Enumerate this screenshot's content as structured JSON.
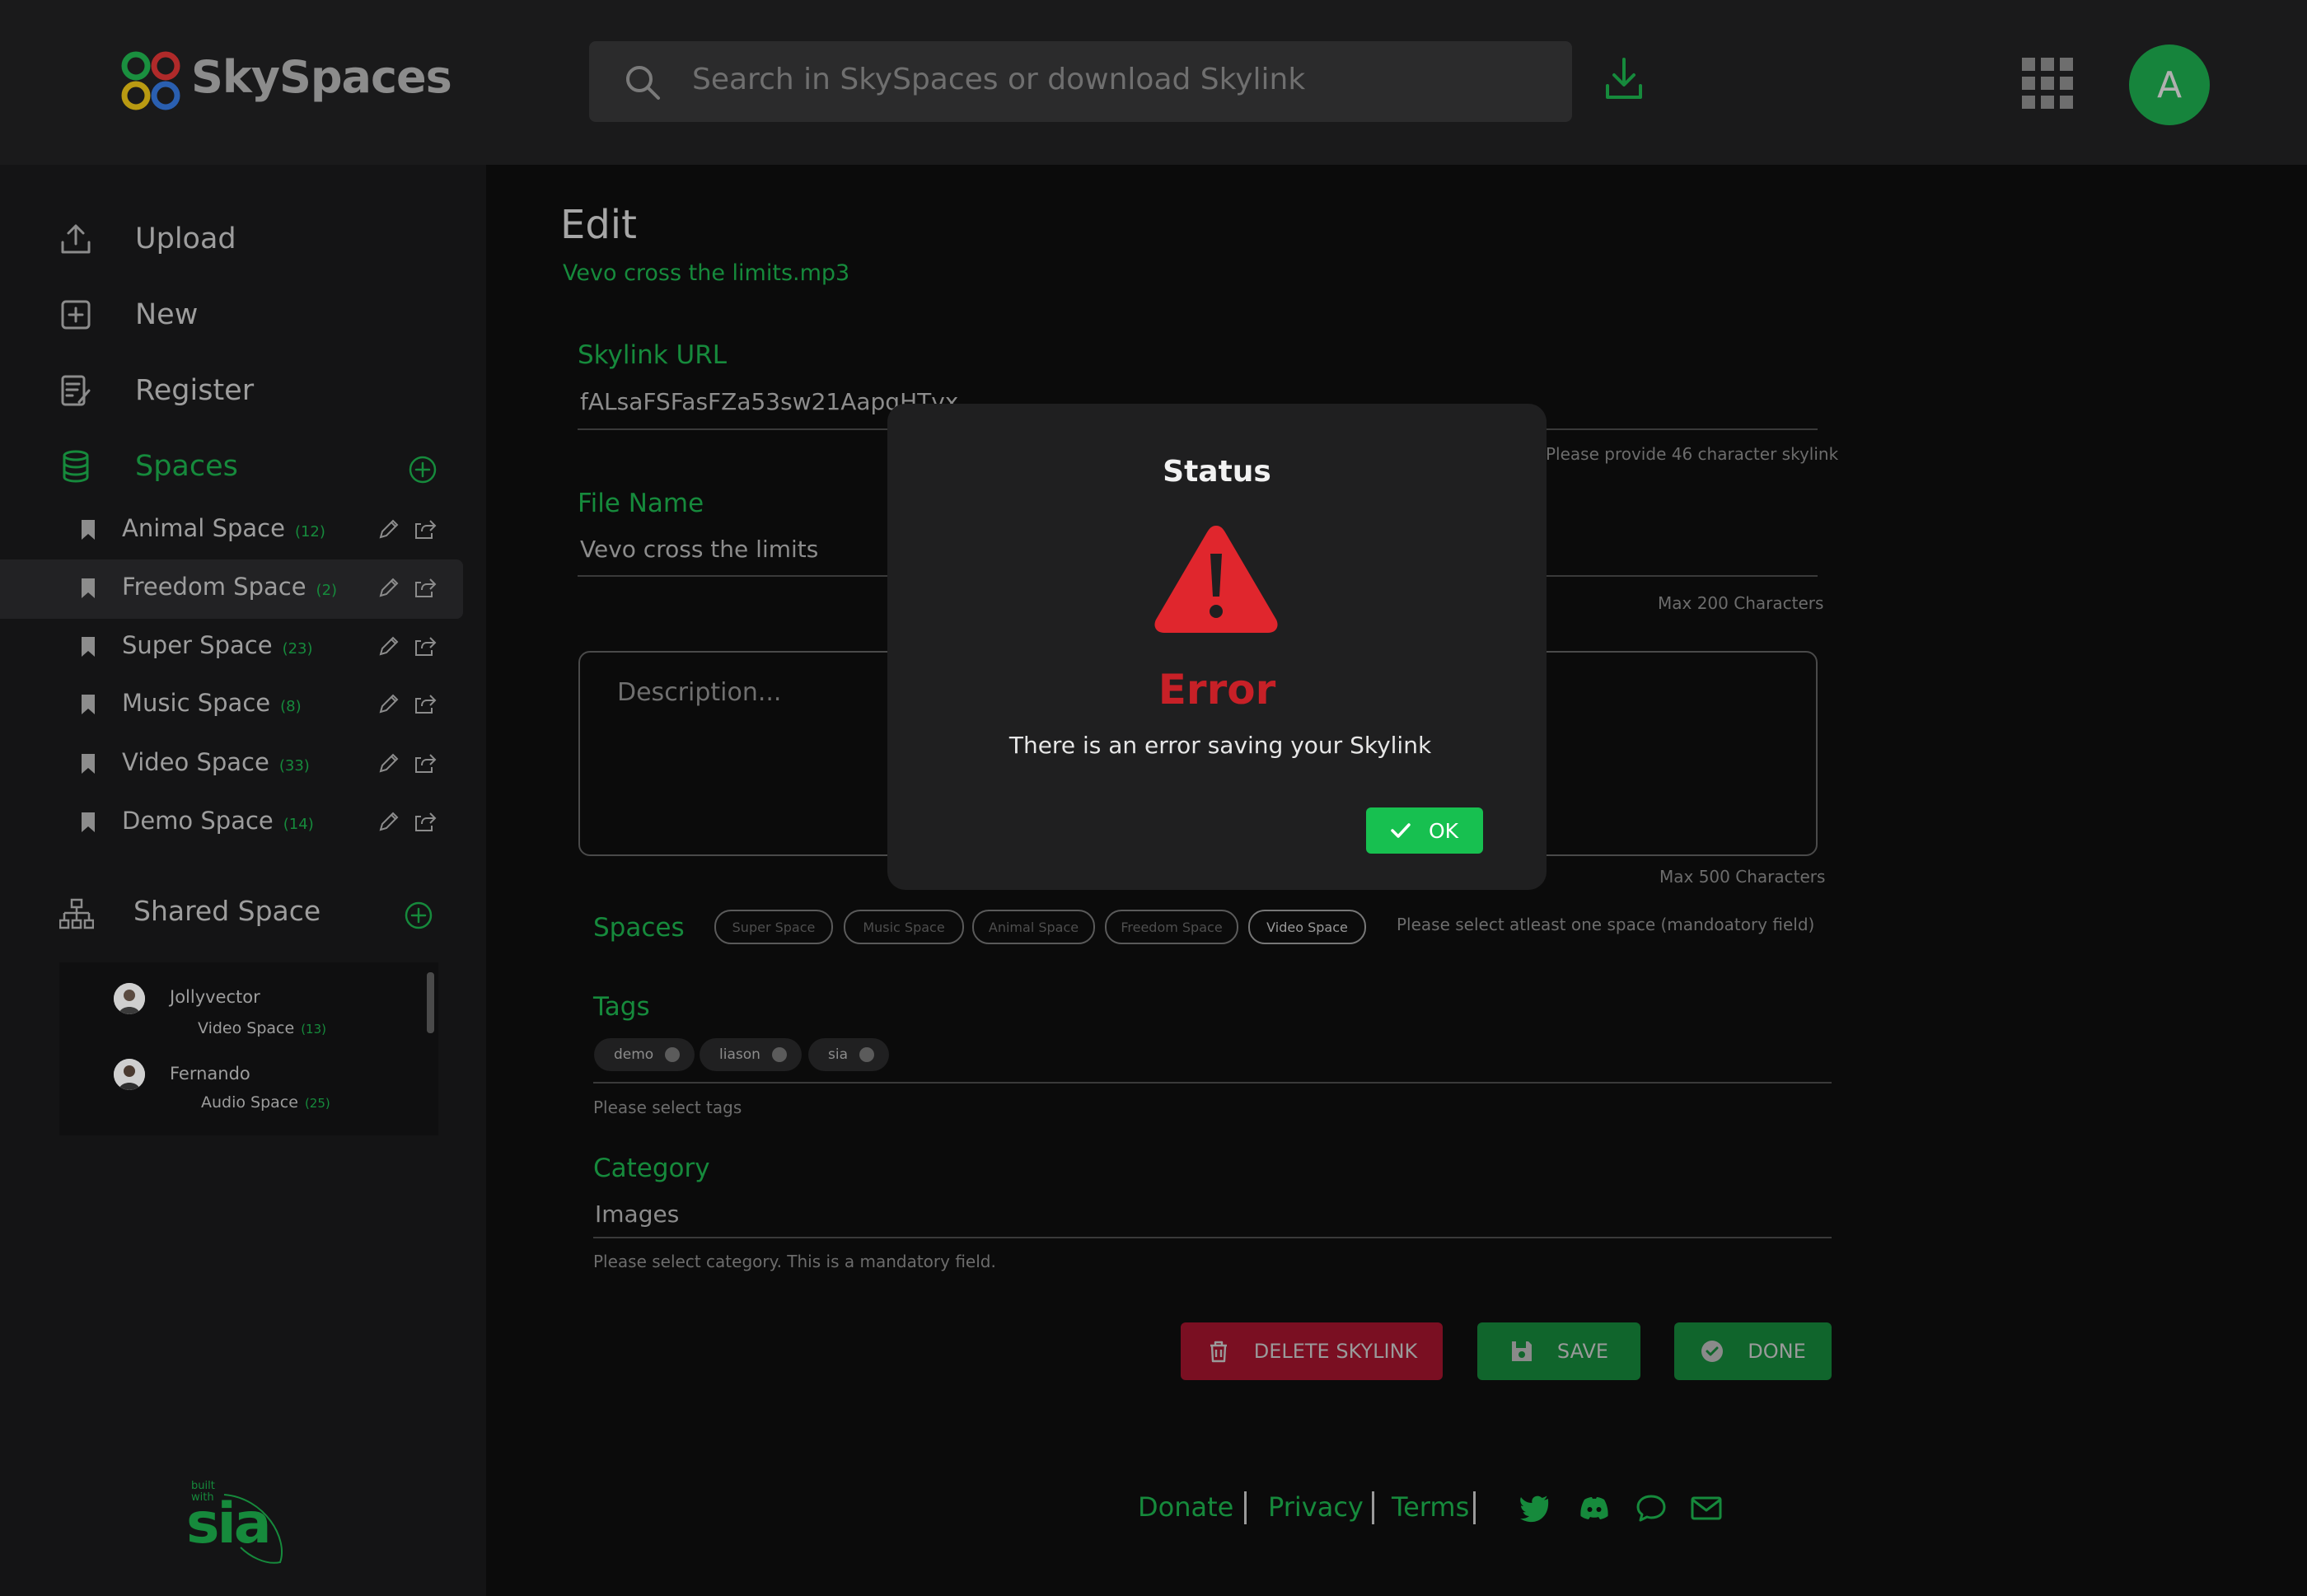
{
  "header": {
    "brand": "SkySpaces",
    "search_placeholder": "Search in SkySpaces or download Skylink",
    "avatar_initial": "A"
  },
  "sidebar": {
    "nav": [
      {
        "label": "Upload",
        "icon": "upload-icon"
      },
      {
        "label": "New",
        "icon": "plus-square-icon"
      },
      {
        "label": "Register",
        "icon": "register-icon"
      },
      {
        "label": "Spaces",
        "icon": "database-icon"
      }
    ],
    "spaces": [
      {
        "name": "Animal Space",
        "count": "(12)"
      },
      {
        "name": "Freedom Space",
        "count": "(2)"
      },
      {
        "name": "Super Space",
        "count": "(23)"
      },
      {
        "name": "Music Space",
        "count": "(8)"
      },
      {
        "name": "Video Space",
        "count": "(33)"
      },
      {
        "name": "Demo Space",
        "count": "(14)"
      }
    ],
    "active_space_index": 1,
    "shared_title": "Shared Space",
    "shared": [
      {
        "user": "Jollyvector",
        "space": "Video Space",
        "count": "(13)"
      },
      {
        "user": "Fernando",
        "space": "Audio Space",
        "count": "(25)"
      }
    ],
    "built_with": "built with",
    "sia_logo": "sia"
  },
  "main": {
    "title": "Edit",
    "subtitle": "Vevo cross the limits.mp3",
    "skylink_label": "Skylink URL",
    "skylink_value": "fALsaFSFasFZa53sw21AapqHTvx",
    "skylink_hint": "Please provide 46 character skylink",
    "filename_label": "File Name",
    "filename_value": "Vevo cross the limits",
    "filename_hint": "Max 200 Characters",
    "description_placeholder": "Description...",
    "description_hint": "Max 500 Characters",
    "spaces_label": "Spaces",
    "space_chips": [
      "Super Space",
      "Music Space",
      "Animal Space",
      "Freedom Space",
      "Video Space"
    ],
    "spaces_hint": "Please select atleast one space (mandoatory field)",
    "tags_label": "Tags",
    "tags": [
      "demo",
      "liason",
      "sia"
    ],
    "tags_hint": "Please select tags",
    "category_label": "Category",
    "category_value": "Images",
    "category_hint": "Please select category. This is a mandatory field.",
    "buttons": {
      "delete": "DELETE SKYLINK",
      "save": "SAVE",
      "done": "DONE"
    }
  },
  "footer": {
    "links": [
      "Donate",
      "Privacy",
      "Terms"
    ],
    "social": [
      "twitter-icon",
      "discord-icon",
      "chat-icon",
      "mail-icon"
    ]
  },
  "modal": {
    "title": "Status",
    "heading": "Error",
    "message": "There is an error saving your Skylink",
    "ok": "OK"
  },
  "colors": {
    "accent_green": "#168a3c",
    "ok_green": "#17c050",
    "error_red": "#c72027",
    "delete_red": "#7a0f22"
  }
}
